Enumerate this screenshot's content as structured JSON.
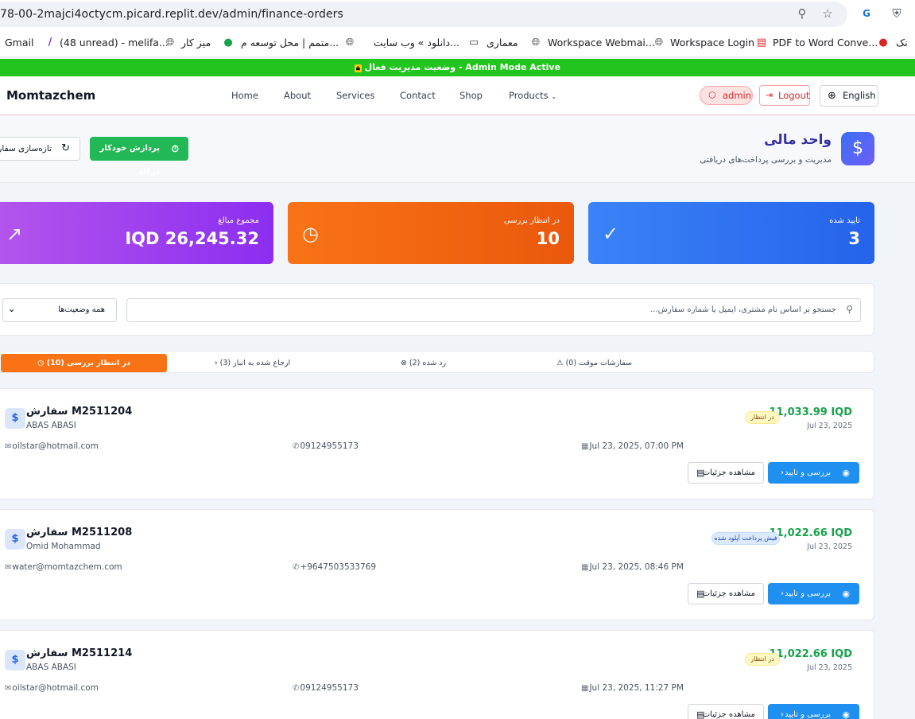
{
  "browser": {
    "url": "78-00-2majci4octycm.picard.replit.dev/admin/finance-orders",
    "bookmarks": [
      {
        "label": "Gmail"
      },
      {
        "label": "(48 unread) - melifa..."
      },
      {
        "label": "میز کار"
      },
      {
        "label": "متمم | محل توسعه م..."
      },
      {
        "label": "دانلود » وب سایت..."
      },
      {
        "label": "معماری"
      },
      {
        "label": "Workspace Webmai..."
      },
      {
        "label": "Workspace Login"
      },
      {
        "label": "PDF to Word Conve..."
      },
      {
        "label": "نک"
      }
    ]
  },
  "admin_bar": {
    "text": "وضعیت مدیریت فعال - Admin Mode Active"
  },
  "nav": {
    "brand": "Momtazchem",
    "links": [
      "Home",
      "About",
      "Services",
      "Contact",
      "Shop",
      "Products"
    ],
    "admin_pill": "admin",
    "logout": "Logout",
    "language": "English"
  },
  "header": {
    "title": "واحد مالی",
    "subtitle": "مدیریت و بررسی پرداخت‌های دریافتی",
    "auto_btn": "پردازش خودکار درگاه",
    "refresh_btn": "تازه‌سازی سفارشات"
  },
  "stats": {
    "total": {
      "label": "مجموع مبالغ",
      "value": "IQD 26,245.32"
    },
    "pending": {
      "label": "در انتظار بررسی",
      "value": "10"
    },
    "approved": {
      "label": "تایید شده",
      "value": "3"
    }
  },
  "filters": {
    "search_placeholder": "جستجو بر اساس نام مشتری، ایمیل یا شماره سفارش...",
    "status_select": "همه وضعیت‌ها"
  },
  "tabs": [
    {
      "label": "در انتظار بررسی (10)",
      "active": true
    },
    {
      "label": "ارجاع شده به انبار (3)"
    },
    {
      "label": "رد شده (2)"
    },
    {
      "label": "سفارشات موقت (0)"
    }
  ],
  "orders": [
    {
      "id": "سفارش M2511204",
      "customer": "ABAS ABASI",
      "amount": "11,033.99 IQD",
      "date_short": "Jul 23, 2025",
      "status": "در انتظار",
      "email": "oilstar@hotmail.com",
      "phone": "09124955173",
      "datetime": "Jul 23, 2025, 07:00 PM",
      "review_btn": "بررسی و تایید",
      "details_btn": "مشاهده جزئیات"
    },
    {
      "id": "سفارش M2511208",
      "customer": "Omid Mohammad",
      "amount": "11,022.66 IQD",
      "date_short": "Jul 23, 2025",
      "status": "فیش پرداخت آپلود شده",
      "email": "water@momtazchem.com",
      "phone": "+9647503533769",
      "datetime": "Jul 23, 2025, 08:46 PM",
      "review_btn": "بررسی و تایید",
      "details_btn": "مشاهده جزئیات"
    },
    {
      "id": "سفارش M2511214",
      "customer": "ABAS ABASI",
      "amount": "11,022.66 IQD",
      "date_short": "Jul 23, 2025",
      "status": "در انتظار",
      "email": "oilstar@hotmail.com",
      "phone": "09124955173",
      "datetime": "Jul 23, 2025, 11:27 PM",
      "review_btn": "بررسی و تایید",
      "details_btn": "مشاهده جزئیات"
    }
  ],
  "colors": {
    "admin_bar": "#22c51e",
    "accent_green": "#16a34a",
    "stat_purple": "#9333ea",
    "stat_orange": "#f97316",
    "stat_blue": "#3b82f6",
    "review_button": "#1f8ff0"
  },
  "icons": {
    "zoom": "zoom-icon",
    "star": "star-icon",
    "translate": "translate-icon",
    "shield": "shield-icon",
    "dollar": "dollar-icon",
    "refresh": "refresh-icon",
    "timer": "timer-icon",
    "trending": "trending-up-icon",
    "clock": "clock-icon",
    "check": "check-circle-icon",
    "search": "search-icon",
    "mail": "mail-icon",
    "phone": "phone-icon",
    "calendar": "calendar-icon",
    "eye": "eye-icon",
    "document": "document-icon"
  }
}
